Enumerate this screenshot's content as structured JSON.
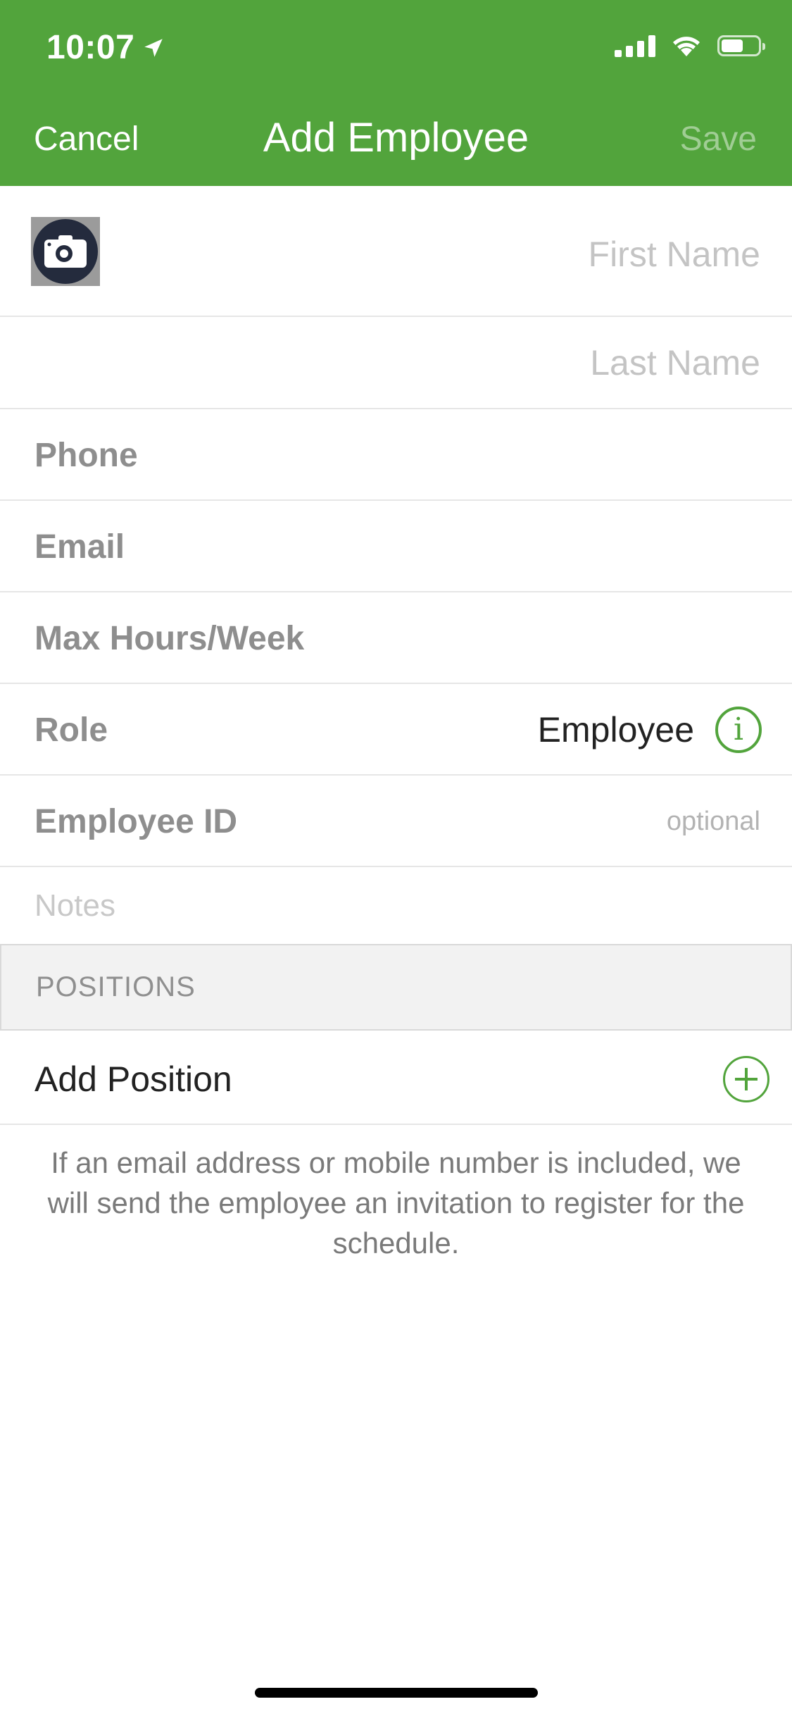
{
  "status_bar": {
    "time": "10:07",
    "battery_level": 0.6
  },
  "nav": {
    "cancel_label": "Cancel",
    "title": "Add Employee",
    "save_label": "Save"
  },
  "form": {
    "first_name_placeholder": "First Name",
    "last_name_placeholder": "Last Name",
    "phone_label": "Phone",
    "email_label": "Email",
    "max_hours_label": "Max Hours/Week",
    "role_label": "Role",
    "role_value": "Employee",
    "info_icon_glyph": "i",
    "employee_id_label": "Employee ID",
    "employee_id_hint": "optional",
    "notes_placeholder": "Notes"
  },
  "positions": {
    "header": "POSITIONS",
    "add_label": "Add Position"
  },
  "footer_note": "If an email address or mobile number is included, we will send the employee an invitation to register for the schedule.",
  "colors": {
    "brand_green": "#52a43c",
    "photo_circle": "#242b3d"
  }
}
